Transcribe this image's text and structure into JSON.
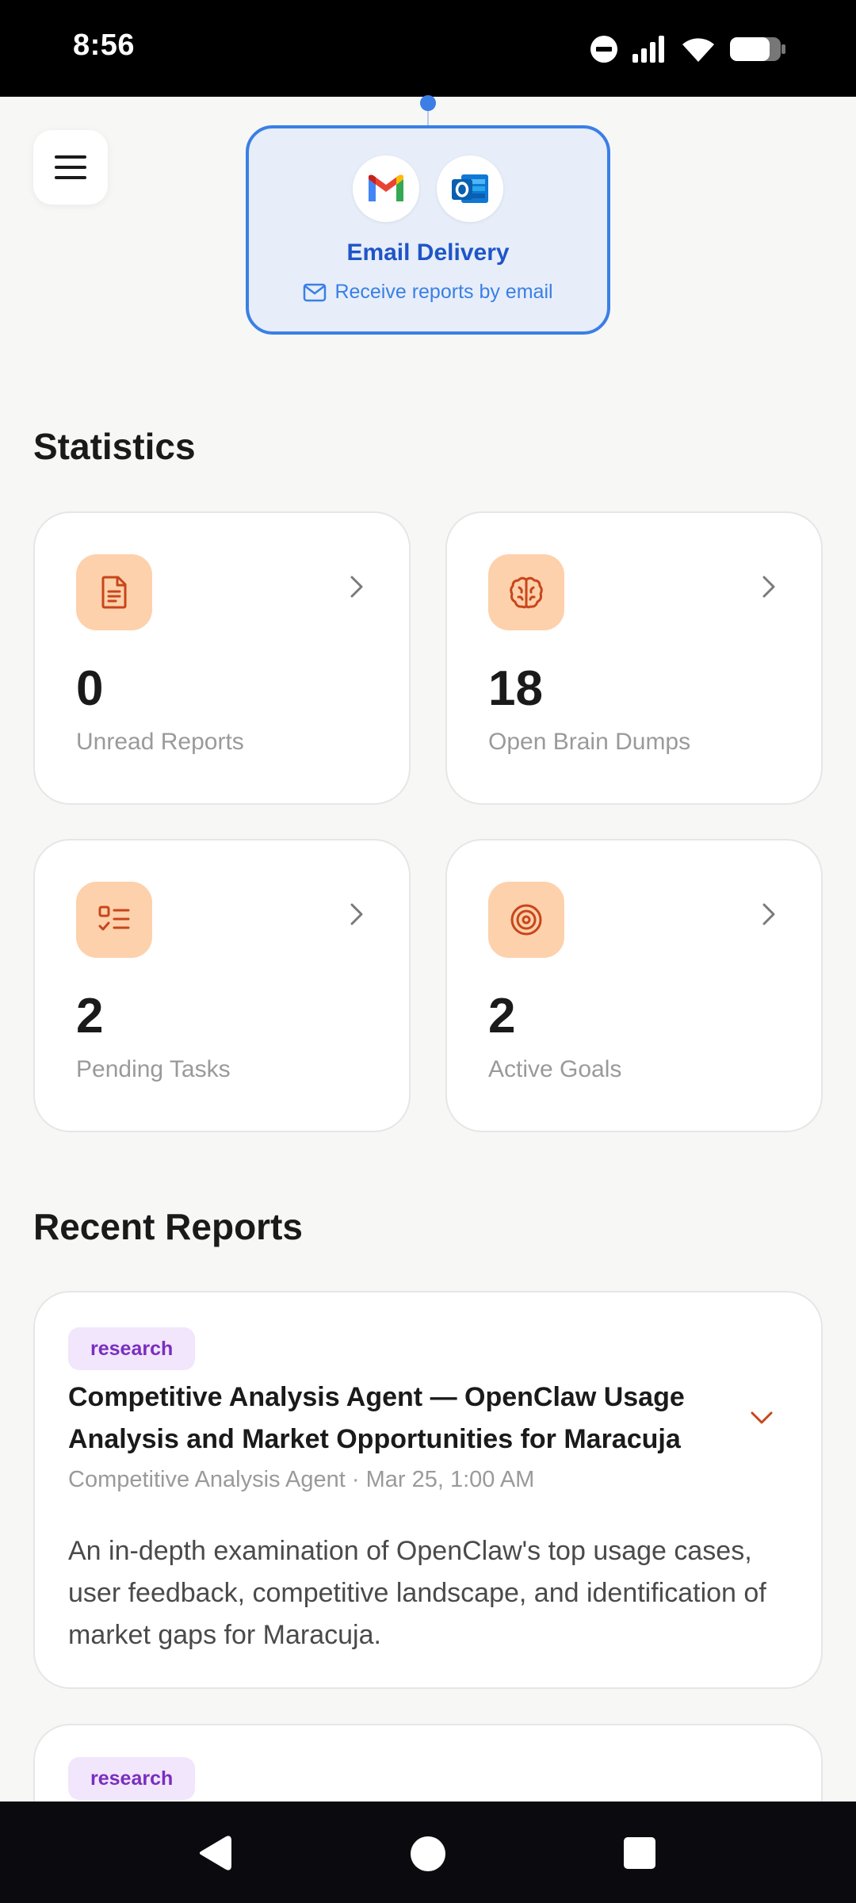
{
  "status_bar": {
    "time": "8:56",
    "icons": [
      "do-not-disturb-icon",
      "signal-icon",
      "wifi-icon",
      "battery-icon"
    ]
  },
  "header": {
    "menu_icon": "hamburger-menu-icon"
  },
  "email_delivery": {
    "title": "Email Delivery",
    "subtitle": "Receive reports by email",
    "logos": [
      "gmail-logo",
      "outlook-logo"
    ],
    "accent": "#3a7fe6"
  },
  "statistics": {
    "title": "Statistics",
    "cards": [
      {
        "value": "0",
        "label": "Unread Reports",
        "icon": "document-icon"
      },
      {
        "value": "18",
        "label": "Open Brain Dumps",
        "icon": "brain-icon"
      },
      {
        "value": "2",
        "label": "Pending Tasks",
        "icon": "task-list-icon"
      },
      {
        "value": "2",
        "label": "Active Goals",
        "icon": "target-icon"
      }
    ],
    "icon_bg": "#fdd1ac",
    "icon_color": "#c8461a"
  },
  "recent_reports": {
    "title": "Recent Reports",
    "items": [
      {
        "tag": "research",
        "title": "Competitive Analysis Agent — OpenClaw Usage Analysis and Market Opportunities for Maracuja",
        "meta": "Competitive Analysis Agent · Mar 25, 1:00 AM",
        "description": "An in-depth examination of OpenClaw's top usage cases, user feedback, competitive landscape, and identification of market gaps for Maracuja."
      },
      {
        "tag": "research"
      }
    ]
  },
  "nav_bar": {
    "buttons": [
      "back-icon",
      "home-icon",
      "recents-icon"
    ]
  }
}
